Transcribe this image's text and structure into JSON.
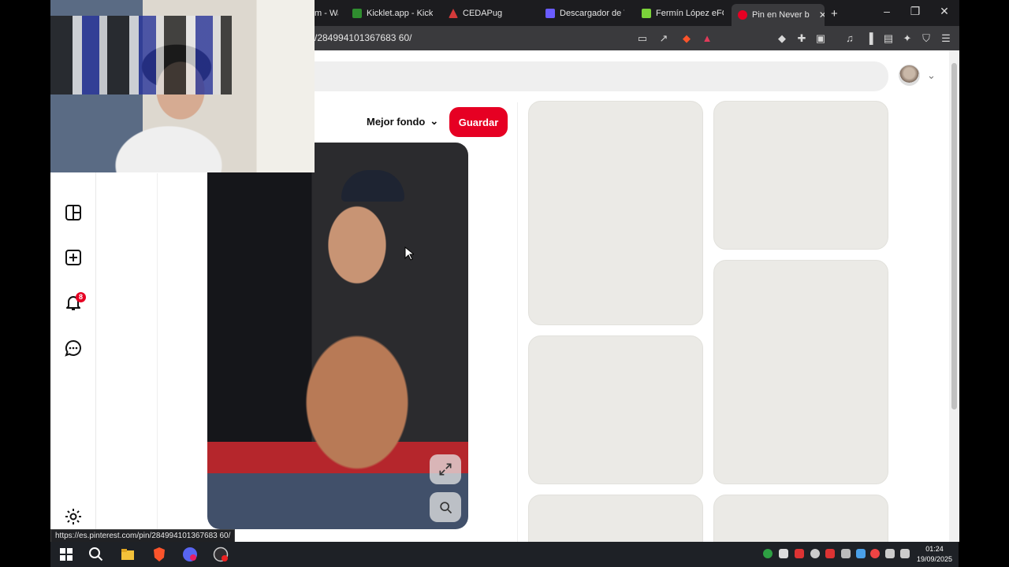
{
  "browser": {
    "tabs": [
      {
        "title": "m - Wa",
        "favicon_color": "#3b3b3b",
        "active": false
      },
      {
        "title": "Kicklet.app - Kick C",
        "favicon_color": "#53fc18",
        "active": false
      },
      {
        "title": "CEDAPug",
        "favicon_color": "#d43a3a",
        "active": false
      },
      {
        "title": "Descargador de Tik",
        "favicon_color": "#6a5cff",
        "active": false
      },
      {
        "title": "Fermín López eFOC",
        "favicon_color": "#7bd23a",
        "active": false
      },
      {
        "title": "Pin en Never b",
        "favicon_color": "#e60023",
        "active": true
      }
    ],
    "new_tab_label": "+",
    "url": "/284994101367683 60/"
  },
  "page": {
    "sort_label": "Mejor fondo",
    "save_label": "Guardar",
    "notification_count": "8"
  },
  "status_url": "https://es.pinterest.com/pin/284994101367683 60/",
  "clock": {
    "time": "01:24",
    "date": "19/09/2025"
  },
  "colors": {
    "brand_red": "#e60023",
    "skeleton": "#ebeae6"
  },
  "icons": {
    "rail": [
      "boards-icon",
      "create-icon",
      "notifications-icon",
      "messages-icon",
      "settings-icon"
    ],
    "pin_controls": [
      "expand-icon",
      "visual-search-icon"
    ]
  }
}
